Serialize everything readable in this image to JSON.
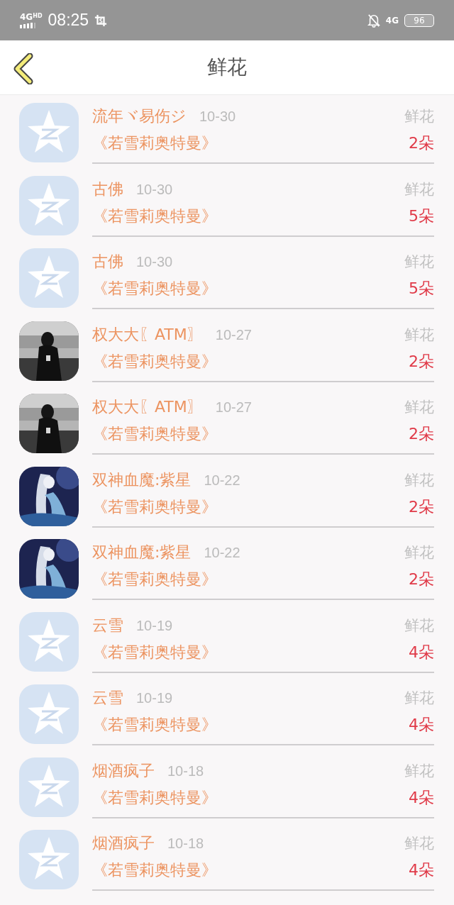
{
  "status_bar": {
    "network": "4G",
    "network_sup": "HD",
    "time": "08:25",
    "right_network": "4G",
    "battery": "96"
  },
  "header": {
    "title": "鲜花"
  },
  "gifts": [
    {
      "kind": "default",
      "name": "流年ヾ易伤ジ",
      "date": "10-30",
      "type": "鲜花",
      "item": "《若雪莉奥特曼》",
      "count": "2朵"
    },
    {
      "kind": "default",
      "name": "古佛",
      "date": "10-30",
      "type": "鲜花",
      "item": "《若雪莉奥特曼》",
      "count": "5朵"
    },
    {
      "kind": "default",
      "name": "古佛",
      "date": "10-30",
      "type": "鲜花",
      "item": "《若雪莉奥特曼》",
      "count": "5朵"
    },
    {
      "kind": "photo-dark",
      "name": "权大大〖ATM〗",
      "date": "10-27",
      "type": "鲜花",
      "item": "《若雪莉奥特曼》",
      "count": "2朵"
    },
    {
      "kind": "photo-dark",
      "name": "权大大〖ATM〗",
      "date": "10-27",
      "type": "鲜花",
      "item": "《若雪莉奥特曼》",
      "count": "2朵"
    },
    {
      "kind": "photo-blue",
      "name": "双神血魔:紫星",
      "date": "10-22",
      "type": "鲜花",
      "item": "《若雪莉奥特曼》",
      "count": "2朵"
    },
    {
      "kind": "photo-blue",
      "name": "双神血魔:紫星",
      "date": "10-22",
      "type": "鲜花",
      "item": "《若雪莉奥特曼》",
      "count": "2朵"
    },
    {
      "kind": "default",
      "name": "云雪",
      "date": "10-19",
      "type": "鲜花",
      "item": "《若雪莉奥特曼》",
      "count": "4朵"
    },
    {
      "kind": "default",
      "name": "云雪",
      "date": "10-19",
      "type": "鲜花",
      "item": "《若雪莉奥特曼》",
      "count": "4朵"
    },
    {
      "kind": "default",
      "name": "烟酒疯子",
      "date": "10-18",
      "type": "鲜花",
      "item": "《若雪莉奥特曼》",
      "count": "4朵"
    },
    {
      "kind": "default",
      "name": "烟酒疯子",
      "date": "10-18",
      "type": "鲜花",
      "item": "《若雪莉奥特曼》",
      "count": "4朵"
    }
  ]
}
